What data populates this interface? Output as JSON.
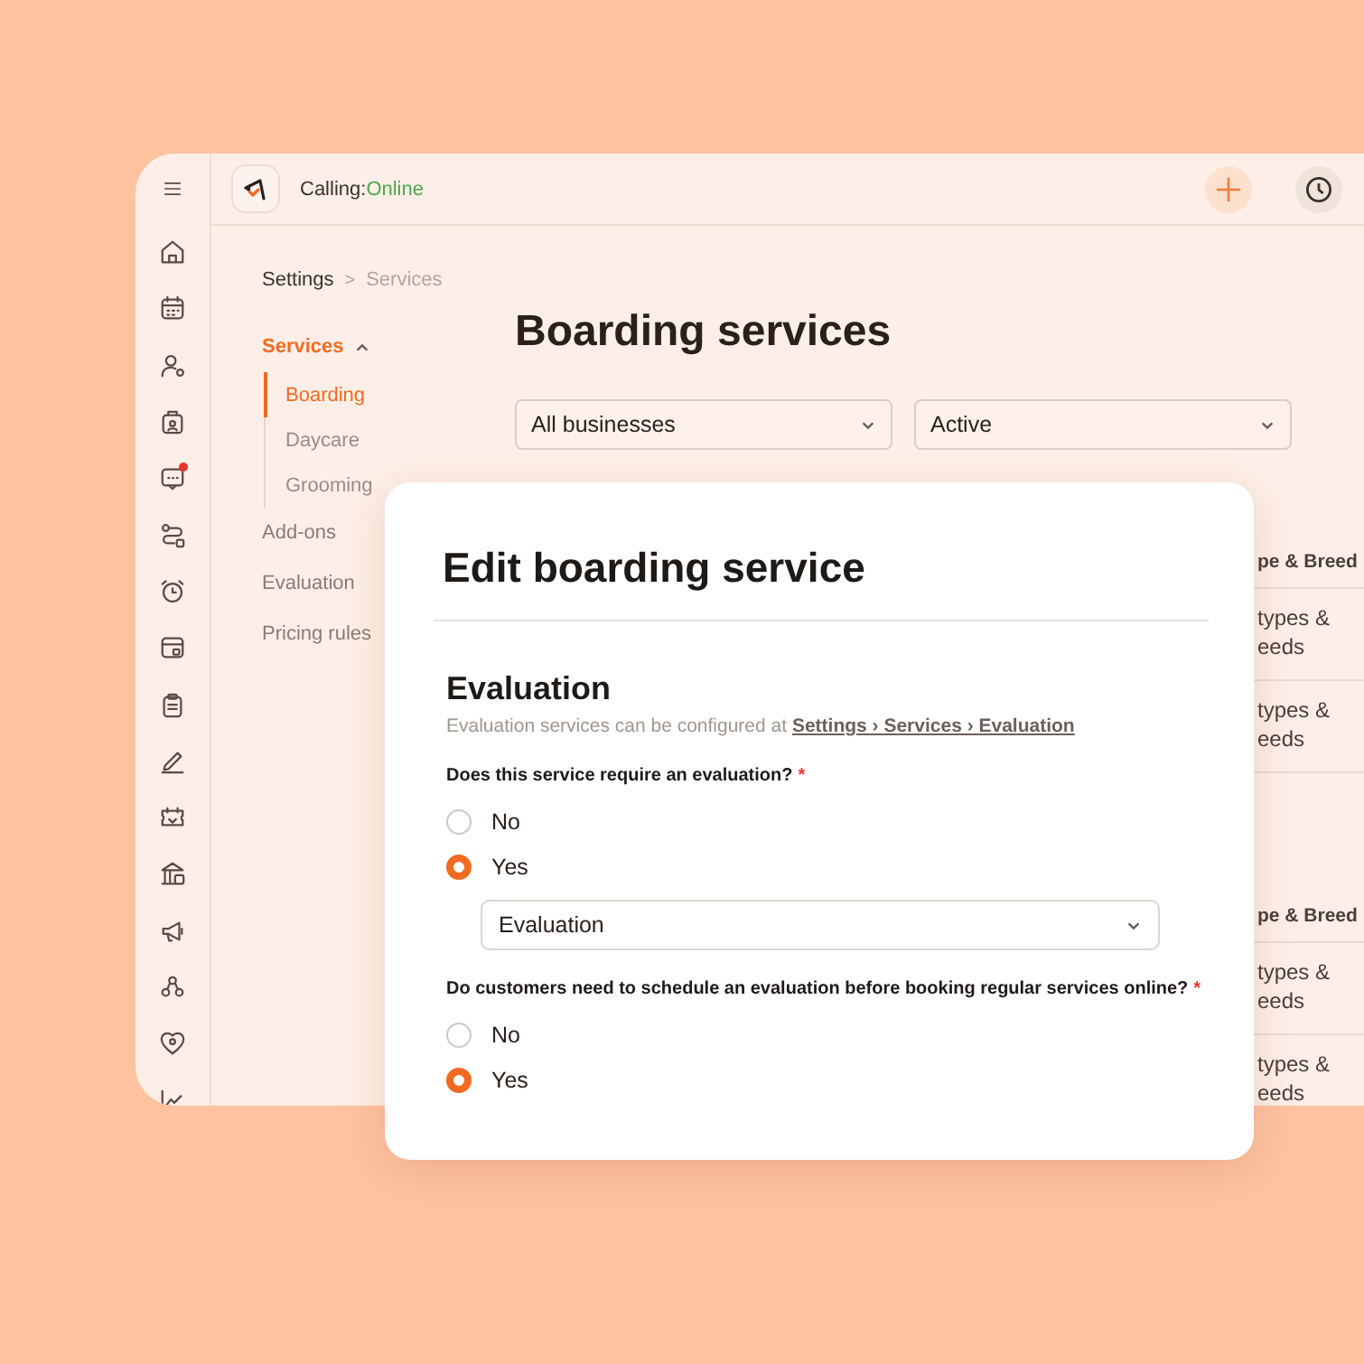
{
  "topbar": {
    "calling_label": "Calling:",
    "calling_status": "Online"
  },
  "rail": [
    {
      "badge": false
    },
    {
      "badge": false
    },
    {
      "badge": false
    },
    {
      "badge": false
    },
    {
      "badge": true
    },
    {
      "badge": false
    },
    {
      "badge": false
    },
    {
      "badge": false
    },
    {
      "badge": false
    },
    {
      "badge": false
    },
    {
      "badge": false
    },
    {
      "badge": false
    },
    {
      "badge": false
    },
    {
      "badge": false
    },
    {
      "badge": false
    },
    {
      "badge": false
    }
  ],
  "breadcrumb": [
    {
      "label": "Settings",
      "separator": ">"
    },
    {
      "label": "Services"
    }
  ],
  "subnav": [
    {
      "label": "Services",
      "selected": true,
      "expanded": true,
      "children": [
        {
          "label": "Boarding",
          "selected": true
        },
        {
          "label": "Daycare",
          "selected": false
        },
        {
          "label": "Grooming",
          "selected": false
        }
      ]
    },
    {
      "label": "Add-ons",
      "selected": false
    },
    {
      "label": "Evaluation",
      "selected": false
    },
    {
      "label": "Pricing rules",
      "selected": false
    }
  ],
  "page_title": "Boarding services",
  "filters": [
    {
      "value": "All businesses"
    },
    {
      "value": "Active"
    }
  ],
  "tables": [
    {
      "header": "pe & Breed",
      "rows": [
        "types & eeds",
        "types & eeds"
      ]
    },
    {
      "header": "pe & Breed",
      "rows": [
        "types & eeds",
        "types & eeds"
      ]
    }
  ],
  "modal": {
    "title": "Edit boarding service",
    "section_title": "Evaluation",
    "hint": "Evaluation services can be configured at",
    "hint_link": "Settings › Services › Evaluation",
    "questions": [
      {
        "label": "Does this service require an evaluation?",
        "required_mark": "*",
        "options": [
          {
            "label": "No",
            "selected": false
          },
          {
            "label": "Yes",
            "selected": true
          }
        ],
        "select": {
          "value": "Evaluation"
        }
      },
      {
        "label": "Do customers need to schedule an evaluation before booking regular services online?",
        "required_mark": "*",
        "options": [
          {
            "label": "No",
            "selected": false
          },
          {
            "label": "Yes",
            "selected": true
          }
        ]
      }
    ]
  }
}
